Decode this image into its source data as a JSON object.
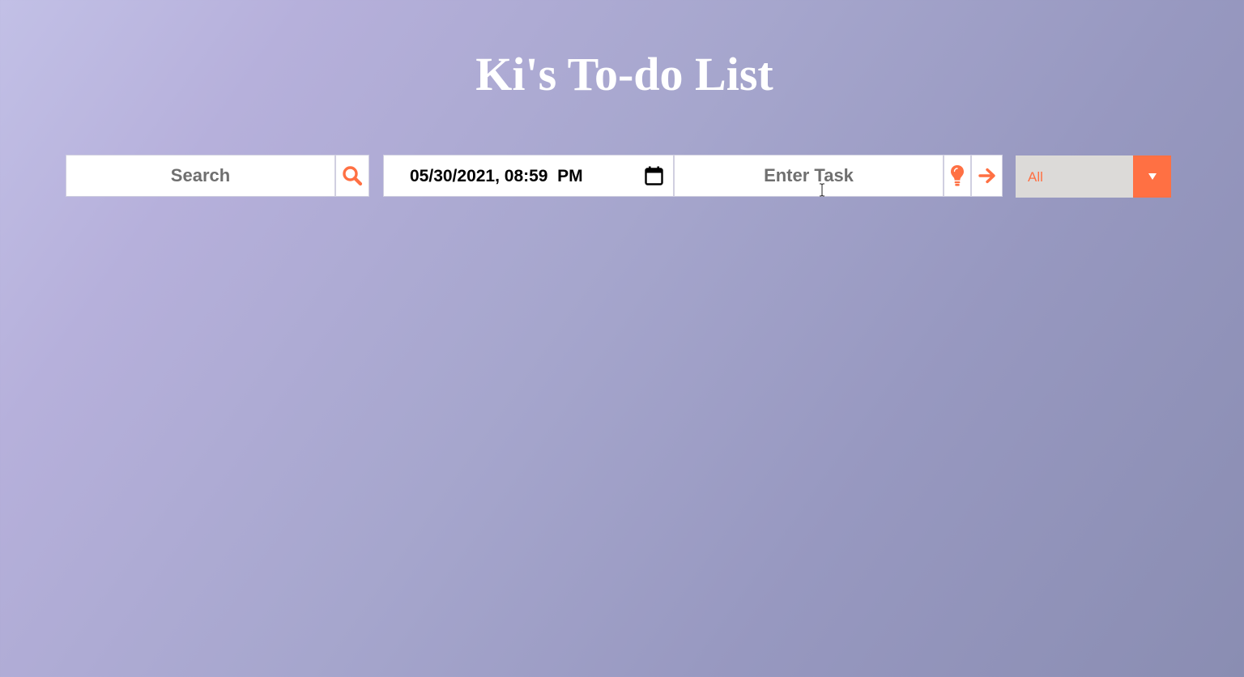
{
  "header": {
    "title": "Ki's To-do List"
  },
  "search": {
    "placeholder": "Search",
    "icon": "search-icon"
  },
  "datetime": {
    "value": "05/30/2021, 08:59  PM",
    "icon": "calendar-icon"
  },
  "task": {
    "placeholder": "Enter Task",
    "idea_icon": "lightbulb-icon",
    "submit_icon": "arrow-right-icon"
  },
  "filter": {
    "selected": "All",
    "icon": "caret-down-icon"
  },
  "colors": {
    "accent": "#ff7043",
    "title": "#ffffff",
    "select_bg": "#dcdad8"
  }
}
